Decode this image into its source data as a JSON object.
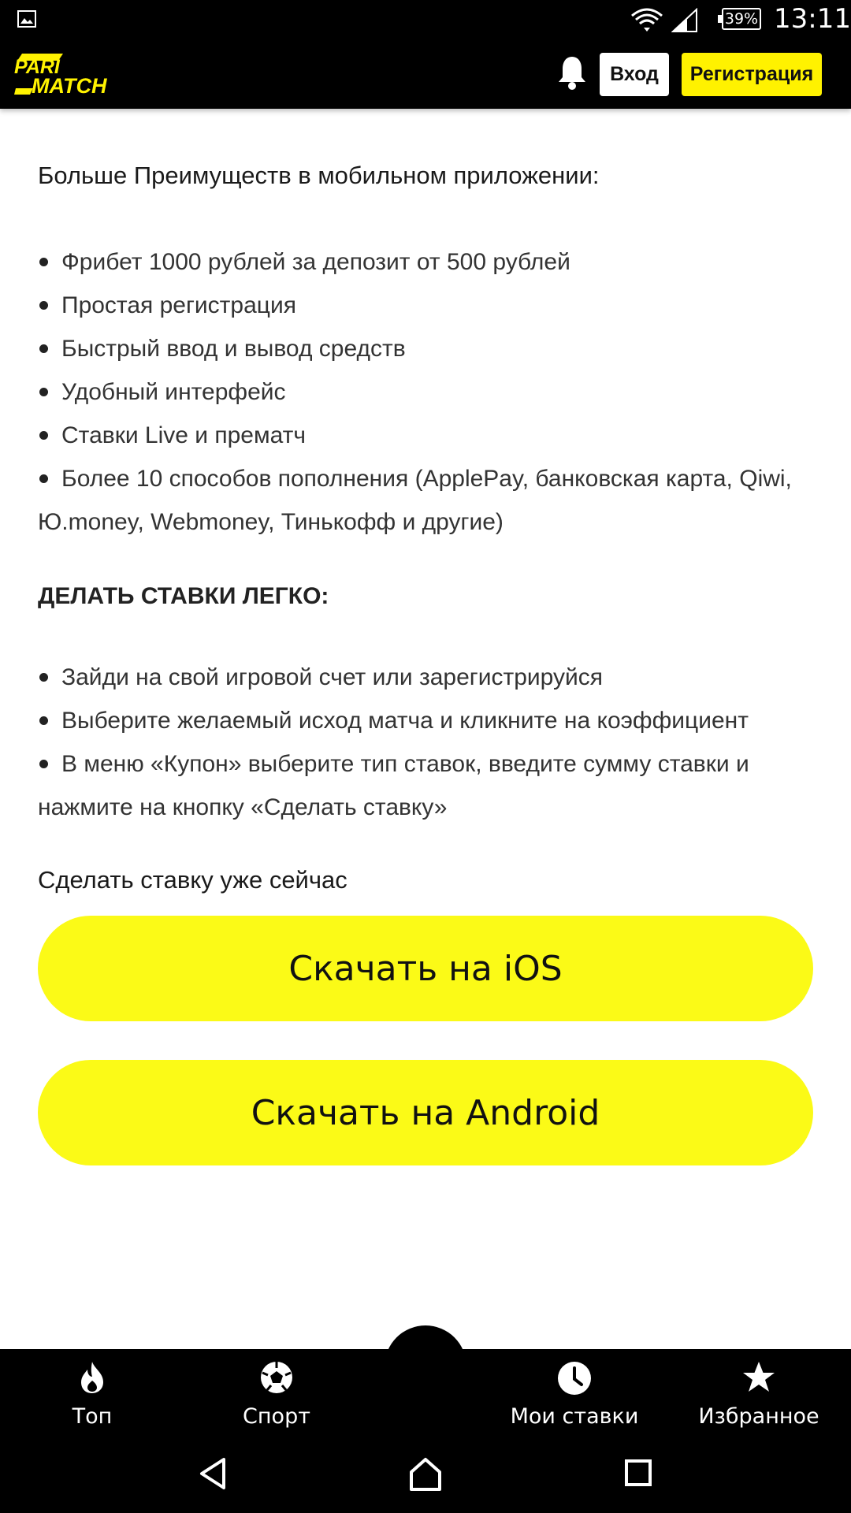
{
  "status_bar": {
    "battery": "39%",
    "time": "13:11",
    "icons": [
      "image-icon",
      "wifi-icon",
      "signal-icon",
      "battery-icon"
    ]
  },
  "header": {
    "logo_line1": "PARI",
    "logo_line2": "MATCH",
    "login_label": "Вход",
    "register_label": "Регистрация",
    "accent_color": "#fff200"
  },
  "content": {
    "intro": "Больше Преимуществ в мобильном приложении:",
    "benefits": [
      "Фрибет 1000 рублей за депозит от 500 рублей",
      "Простая регистрация",
      "Быстрый ввод и вывод средств",
      "Удобный интерфейс",
      "Ставки Live и прематч",
      "Более 10 способов пополнения (ApplePay, банковская карта, Qiwi,",
      "Ю.money, Webmoney, Тинькофф и другие)"
    ],
    "section_title": "ДЕЛАТЬ СТАВКИ ЛЕГКО:",
    "steps": [
      "Зайди на свой игровой счет или зарегистрируйся",
      "Выберите желаемый исход матча и кликните на коэффициент",
      "В меню «Купон» выберите тип ставок, введите сумму ставки и",
      "нажмите на кнопку «Сделать ставку»"
    ],
    "cta_text": "Сделать ставку уже сейчас",
    "ios_button": "Скачать на iOS",
    "android_button": "Скачать на Android",
    "button_color": "#fbfa17"
  },
  "bottom_nav": {
    "items": [
      {
        "label": "Топ",
        "icon": "flame-icon"
      },
      {
        "label": "Спорт",
        "icon": "soccer-ball-icon"
      },
      {
        "label": "Мои ставки",
        "icon": "clock-icon"
      },
      {
        "label": "Избранное",
        "icon": "star-icon"
      }
    ]
  },
  "system_nav": {
    "icons": [
      "back-icon",
      "home-icon",
      "recents-icon"
    ]
  }
}
